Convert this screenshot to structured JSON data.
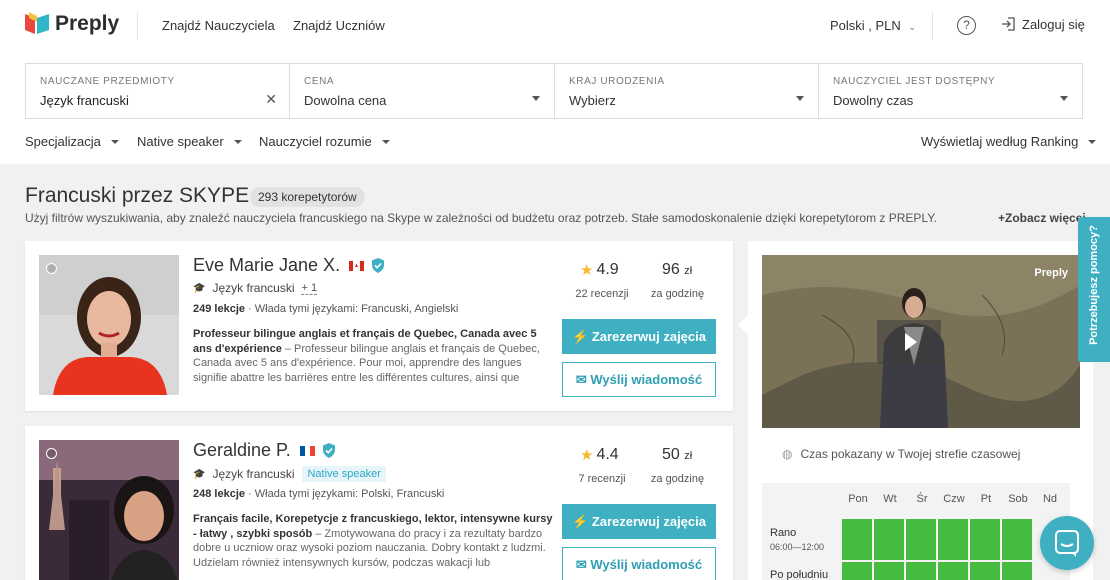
{
  "header": {
    "brand": "Preply",
    "nav": [
      "Znajdź Nauczyciela",
      "Znajdź Uczniów"
    ],
    "lang_currency": "Polski , PLN",
    "help_glyph": "?",
    "login": "Zaloguj się"
  },
  "filters": {
    "subject": {
      "label": "NAUCZANE PRZEDMIOTY",
      "value": "Język francuski"
    },
    "price": {
      "label": "CENA",
      "value": "Dowolna cena"
    },
    "country": {
      "label": "KRAJ URODZENIA",
      "value": "Wybierz"
    },
    "availability": {
      "label": "NAUCZYCIEL JEST DOSTĘPNY",
      "value": "Dowolny czas"
    },
    "sub": {
      "specialization": "Specjalizacja",
      "native": "Native speaker",
      "understands": "Nauczyciel rozumie",
      "sort": "Wyświetlaj według Ranking"
    }
  },
  "page": {
    "title": "Francuski przez SKYPE",
    "count": "293 korepetytorów",
    "description": "Użyj filtrów wyszukiwania, aby znaleźć nauczyciela francuskiego na Skype w zależności od budżetu oraz potrzeb. Stałe samodoskonalenie dzięki korepetytorom z PREPLY.",
    "see_more": "+Zobacz więcej"
  },
  "tutors": [
    {
      "name": "Eve Marie Jane X.",
      "subject": "Język francuski",
      "extra": "+ 1",
      "lessons": "249 lekcje",
      "languages": " · Włada tymi językami: Francuski, Angielski",
      "bio_bold": "Professeur bilingue anglais et français de Quebec, Canada avec 5 ans d'expérience",
      "bio": " – Professeur bilingue anglais et français de Quebec, Canada avec 5 ans d'expérience. Pour moi, apprendre des langues signifie abattre les barrières entre les différentes cultures, ainsi que",
      "rating": "4.9",
      "reviews": "22 recenzji",
      "price": "96",
      "currency": "zł",
      "per": "za godzinę",
      "book": "Zarezerwuj zajęcia",
      "message": "Wyślij wiadomość"
    },
    {
      "name": "Geraldine P.",
      "subject": "Język francuski",
      "badge": "Native speaker",
      "lessons": "248 lekcje",
      "languages": " · Włada tymi językami: Polski, Francuski",
      "bio_bold": "Français facile, Korepetycje z francuskiego, lektor, intensywne kursy - łatwy , szybki sposób",
      "bio": " – Zmotywowana do pracy i za rezultaty bardzo dobre u uczniow oraz wysoki poziom nauczania. Dobry kontakt z ludzmi. Udzielam również intensywnych kursów, podczas wakacji lub",
      "rating": "4.4",
      "reviews": "7 recenzji",
      "price": "50",
      "currency": "zł",
      "per": "za godzinę",
      "book": "Zarezerwuj zajęcia",
      "message": "Wyślij wiadomość"
    }
  ],
  "side": {
    "video_logo": "Preply",
    "timezone_note": "Czas pokazany w Twojej strefie czasowej",
    "days": [
      "Pon",
      "Wt",
      "Śr",
      "Czw",
      "Pt",
      "Sob",
      "Nd"
    ],
    "slots": [
      {
        "label": "Rano",
        "time": "06:00—12:00"
      },
      {
        "label": "Po południu",
        "time": ""
      }
    ]
  },
  "help_tab": "Potrzebujesz pomocy?",
  "colors": {
    "accent": "#3fb0c2",
    "available": "#45bb3f",
    "star": "#f5b82e"
  }
}
